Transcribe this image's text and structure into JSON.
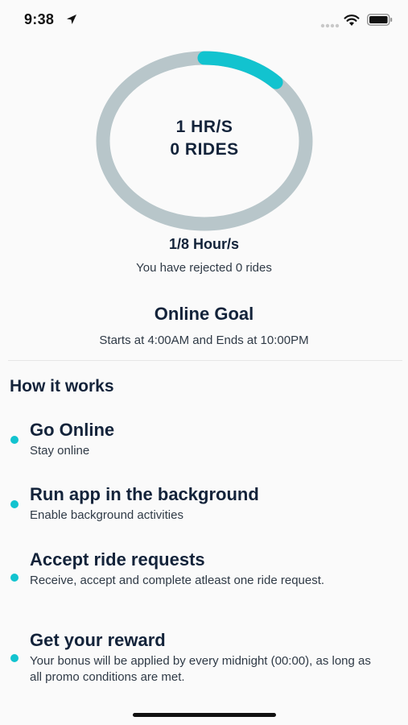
{
  "status_bar": {
    "time": "9:38",
    "icons": [
      "location-arrow-icon",
      "signal-icon",
      "wifi-icon",
      "battery-icon"
    ]
  },
  "progress_ring": {
    "line1": "1 HR/S",
    "line2": "0 RIDES",
    "progress_fraction": 0.125,
    "track_color": "#b8c6ca",
    "progress_color": "#12c3cf"
  },
  "summary": {
    "progress_label": "1/8 Hour/s",
    "rejected_text": "You have rejected 0 rides"
  },
  "goal": {
    "title": "Online Goal",
    "times": "Starts at 4:00AM and Ends at 10:00PM"
  },
  "how_it_works": {
    "title": "How it works",
    "bullet_color": "#12c3cf",
    "steps": [
      {
        "title": "Go Online",
        "desc": "Stay online"
      },
      {
        "title": "Run app in the background",
        "desc": "Enable background activities"
      },
      {
        "title": "Accept ride requests",
        "desc": "Receive, accept and complete atleast one ride request."
      },
      {
        "title": "Get your reward",
        "desc": "Your bonus will be applied by every midnight (00:00), as long as all promo conditions are met."
      }
    ]
  }
}
